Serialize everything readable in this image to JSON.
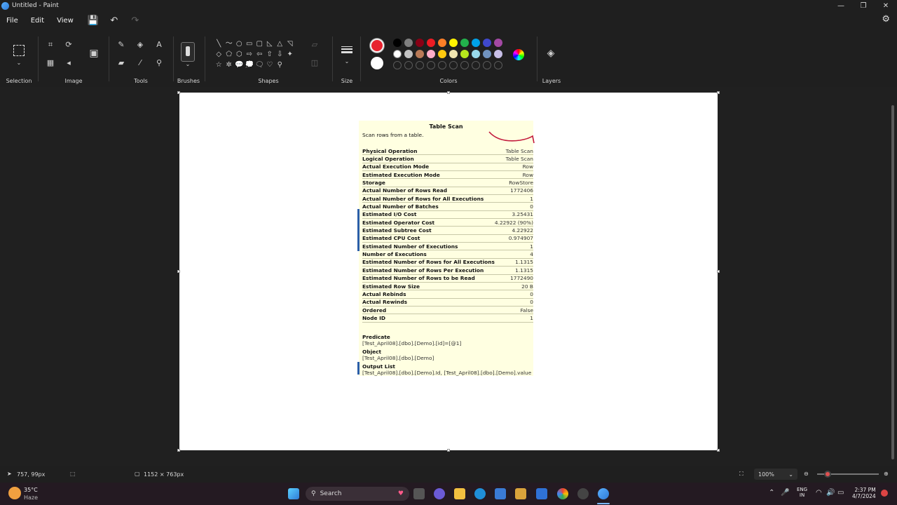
{
  "window": {
    "title": "Untitled - Paint",
    "minimize": "—",
    "restore": "❐",
    "close": "✕"
  },
  "menu": {
    "file": "File",
    "edit": "Edit",
    "view": "View"
  },
  "ribbon": {
    "groups": {
      "selection": "Selection",
      "image": "Image",
      "tools": "Tools",
      "brushes": "Brushes",
      "shapes": "Shapes",
      "size": "Size",
      "colors": "Colors",
      "layers": "Layers"
    },
    "shapes": [
      "╲",
      "〜",
      "○",
      "▭",
      "▢",
      "◺",
      "△",
      "◹",
      "◇",
      "⬠",
      "⬡",
      "⇨",
      "⇦",
      "⇧",
      "⇩",
      "✦",
      "☆",
      "✲",
      "💬",
      "💭",
      "🗨",
      "♡",
      "⚲",
      "",
      ""
    ],
    "palette_row1": [
      "#000000",
      "#7f7f7f",
      "#880015",
      "#ed1c24",
      "#ff7f27",
      "#fff200",
      "#22b14c",
      "#00a2e8",
      "#3f48cc",
      "#a349a4"
    ],
    "palette_row2": [
      "#ffffff",
      "#c3c3c3",
      "#b97a57",
      "#ffaec9",
      "#ffc90e",
      "#efe4b0",
      "#b5e61d",
      "#99d9ea",
      "#7092be",
      "#c8bfe7"
    ],
    "primary_color": "#e8232f",
    "secondary_color": "#ffffff"
  },
  "tooltip": {
    "title": "Table Scan",
    "description": "Scan rows from a table.",
    "rows": [
      {
        "k": "Physical Operation",
        "v": "Table Scan"
      },
      {
        "k": "Logical Operation",
        "v": "Table Scan"
      },
      {
        "k": "Actual Execution Mode",
        "v": "Row"
      },
      {
        "k": "Estimated Execution Mode",
        "v": "Row"
      },
      {
        "k": "Storage",
        "v": "RowStore"
      },
      {
        "k": "Actual Number of Rows Read",
        "v": "1772406"
      },
      {
        "k": "Actual Number of Rows for All Executions",
        "v": "1"
      },
      {
        "k": "Actual Number of Batches",
        "v": "0"
      },
      {
        "k": "Estimated I/O Cost",
        "v": "3.25431"
      },
      {
        "k": "Estimated Operator Cost",
        "v": "4.22922 (90%)"
      },
      {
        "k": "Estimated Subtree Cost",
        "v": "4.22922"
      },
      {
        "k": "Estimated CPU Cost",
        "v": "0.974907"
      },
      {
        "k": "Estimated Number of Executions",
        "v": "1"
      },
      {
        "k": "Number of Executions",
        "v": "4"
      },
      {
        "k": "Estimated Number of Rows for All Executions",
        "v": "1.1315"
      },
      {
        "k": "Estimated Number of Rows Per Execution",
        "v": "1.1315"
      },
      {
        "k": "Estimated Number of Rows to be Read",
        "v": "1772490"
      },
      {
        "k": "Estimated Row Size",
        "v": "20 B"
      },
      {
        "k": "Actual Rebinds",
        "v": "0"
      },
      {
        "k": "Actual Rewinds",
        "v": "0"
      },
      {
        "k": "Ordered",
        "v": "False"
      },
      {
        "k": "Node ID",
        "v": "1"
      }
    ],
    "predicate_label": "Predicate",
    "predicate_value": "[Test_April08].[dbo].[Demo].[id]=[@1]",
    "object_label": "Object",
    "object_value": "[Test_April08].[dbo].[Demo]",
    "output_label": "Output List",
    "output_value": "[Test_April08].[dbo].[Demo].Id, [Test_April08].[dbo].[Demo].value"
  },
  "status": {
    "cursor_pos": "757, 99px",
    "canvas_size": "1152 × 763px",
    "zoom": "100%"
  },
  "taskbar": {
    "weather_temp": "35°C",
    "weather_desc": "Haze",
    "search_label": "Search",
    "lang_top": "ENG",
    "lang_bottom": "IN",
    "time": "2:37 PM",
    "date": "4/7/2024"
  }
}
